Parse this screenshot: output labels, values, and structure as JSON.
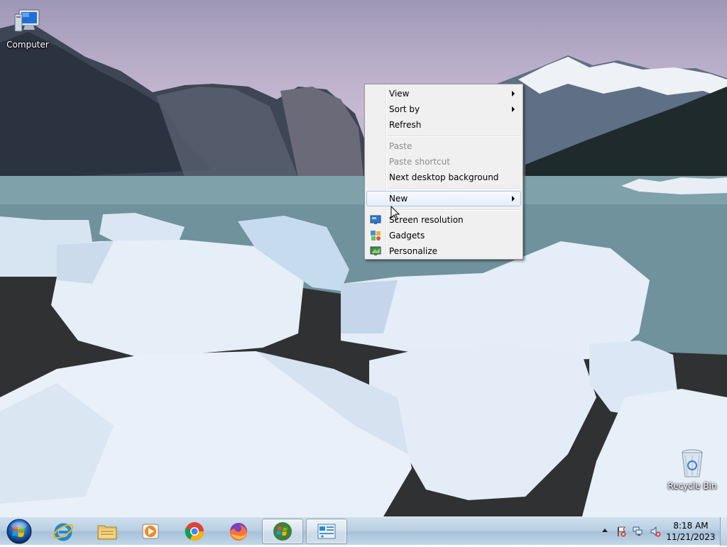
{
  "desktop": {
    "icons": [
      {
        "label": "Computer"
      },
      {
        "label": "Recycle Bin"
      }
    ]
  },
  "context_menu": {
    "items": [
      {
        "label": "View"
      },
      {
        "label": "Sort by"
      },
      {
        "label": "Refresh"
      },
      {
        "label": "Paste"
      },
      {
        "label": "Paste shortcut"
      },
      {
        "label": "Next desktop background"
      },
      {
        "label": "New"
      },
      {
        "label": "Screen resolution"
      },
      {
        "label": "Gadgets"
      },
      {
        "label": "Personalize"
      }
    ]
  },
  "taskbar": {
    "pinned": [
      {
        "icon": "windows-start-orb-icon"
      },
      {
        "icon": "internet-explorer-icon"
      },
      {
        "icon": "file-explorer-icon"
      },
      {
        "icon": "media-player-icon"
      },
      {
        "icon": "chrome-icon"
      },
      {
        "icon": "firefox-icon"
      },
      {
        "icon": "windows-logo-icon"
      },
      {
        "icon": "control-panel-icon"
      }
    ],
    "clock": {
      "time": "8:18 AM",
      "date": "11/21/2023"
    }
  },
  "colors": {
    "menu_bg": "#f0f0f0",
    "menu_hover": "#e4edf9",
    "menu_disabled": "#8d8d8d",
    "taskbar": "#b9cfe2"
  }
}
